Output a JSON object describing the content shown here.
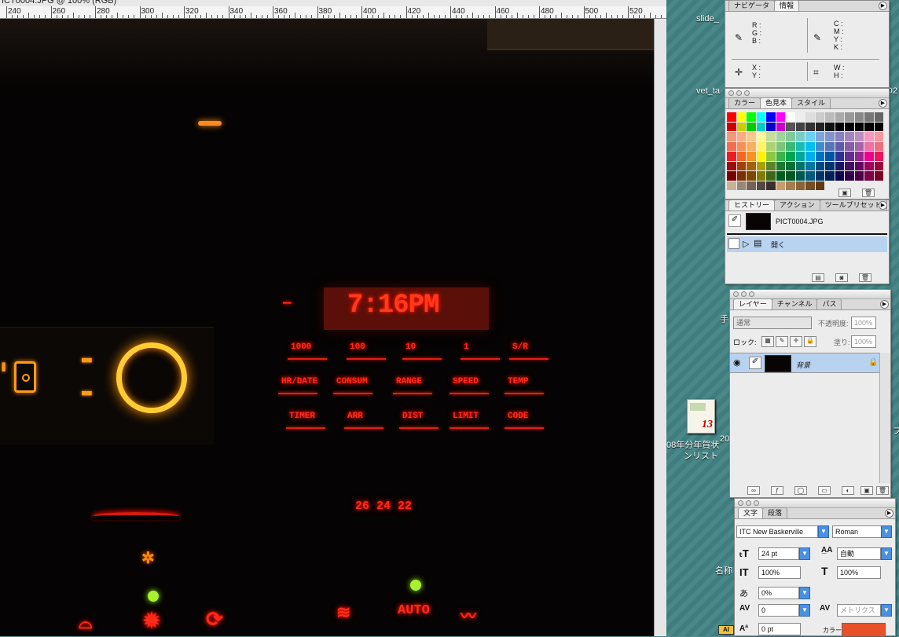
{
  "document": {
    "title": "ICT0004.JPG @ 100% (RGB)",
    "ruler_labels": [
      "240",
      "260",
      "280",
      "300",
      "320",
      "340",
      "360",
      "380",
      "400",
      "420",
      "440",
      "460",
      "480",
      "500",
      "520"
    ]
  },
  "photo": {
    "clock": "7:16PM",
    "top_buttons": [
      "1000",
      "100",
      "10",
      "1",
      "S/R"
    ],
    "mid_buttons": [
      "HR/DATE",
      "CONSUM",
      "RANGE",
      "SPEED",
      "TEMP"
    ],
    "bottom_buttons": [
      "TIMER",
      "ARR",
      "DIST",
      "LIMIT",
      "CODE"
    ],
    "temps": "26  24  22",
    "auto": "AUTO"
  },
  "info_panel": {
    "tabs": [
      "ナビゲータ",
      "情報"
    ],
    "rgb": [
      "R :",
      "G :",
      "B :"
    ],
    "cmyk": [
      "C :",
      "M :",
      "Y :",
      "K :"
    ],
    "xy": [
      "X :",
      "Y :"
    ],
    "wh": [
      "W :",
      "H :"
    ]
  },
  "swatch_panel": {
    "tabs": [
      "カラー",
      "色見本",
      "スタイル"
    ],
    "colors": [
      "#ff0000",
      "#ffff00",
      "#00ff00",
      "#00ffff",
      "#0000ff",
      "#ff00ff",
      "#ffffff",
      "#eeeeee",
      "#dddddd",
      "#cccccc",
      "#bbbbbb",
      "#aaaaaa",
      "#999999",
      "#888888",
      "#777777",
      "#666666",
      "#cc0000",
      "#cccc00",
      "#00cc00",
      "#00cccc",
      "#0000cc",
      "#cc00cc",
      "#555555",
      "#444444",
      "#333333",
      "#222222",
      "#111111",
      "#000000",
      "#000000",
      "#000000",
      "#000000",
      "#000000",
      "#f7977a",
      "#f9ad81",
      "#fdc68a",
      "#fff79a",
      "#c4df9b",
      "#a3d39c",
      "#82ca9d",
      "#7bcdc8",
      "#6ecff6",
      "#7ea7d8",
      "#8493ca",
      "#8882be",
      "#a187be",
      "#bc8dbf",
      "#f49ac2",
      "#f6989d",
      "#f26c4f",
      "#f68e55",
      "#fbaf5c",
      "#fff467",
      "#acd372",
      "#7cc576",
      "#3bb878",
      "#1abbb4",
      "#00bff3",
      "#438ccb",
      "#5574b9",
      "#605ca8",
      "#855fa8",
      "#a763a8",
      "#f06ea9",
      "#f26d7d",
      "#ed1c24",
      "#f26522",
      "#f7941d",
      "#fff200",
      "#8dc73f",
      "#39b54a",
      "#00a651",
      "#00a99d",
      "#00aeef",
      "#0072bc",
      "#0054a6",
      "#2e3192",
      "#662d91",
      "#92278f",
      "#ec008c",
      "#ed145b",
      "#9e0b0f",
      "#a0410d",
      "#a36209",
      "#aba000",
      "#598527",
      "#1a7b30",
      "#007236",
      "#00746b",
      "#0076a3",
      "#004b80",
      "#003471",
      "#1b1464",
      "#440e62",
      "#630460",
      "#9e005d",
      "#9e0039",
      "#790000",
      "#7b2e00",
      "#7d4900",
      "#827b00",
      "#406618",
      "#005e20",
      "#005826",
      "#005952",
      "#005b7f",
      "#003663",
      "#002157",
      "#0d004c",
      "#32004b",
      "#4b0049",
      "#7b0046",
      "#7a0026",
      "#c7b299",
      "#998675",
      "#736357",
      "#534741",
      "#37302d",
      "#c69c6d",
      "#a67c52",
      "#8c6239",
      "#754c24",
      "#603913",
      "#ececec",
      "#ececec",
      "#ececec",
      "#ececec",
      "#ececec",
      "#ececec"
    ]
  },
  "history_panel": {
    "tabs": [
      "ヒストリー",
      "アクション",
      "ツールプリセット"
    ],
    "snapshot": "PICT0004.JPG",
    "state": "開く"
  },
  "layers_panel": {
    "tabs": [
      "レイヤー",
      "チャンネル",
      "パス"
    ],
    "blend_mode": "通常",
    "opacity_label": "不透明度:",
    "opacity_value": "100%",
    "lock_label": "ロック:",
    "fill_label": "塗り:",
    "fill_value": "100%",
    "layer_name": "背景"
  },
  "char_panel": {
    "tabs": [
      "文字",
      "段落"
    ],
    "font": "ITC New Baskerville",
    "style": "Roman",
    "size": "24 pt",
    "leading": "自動",
    "vscale": "100%",
    "hscale": "100%",
    "tsume": "0%",
    "kerning": "0",
    "tracking": "メトリクス",
    "baseline": "0 pt",
    "color_label": "カラー:",
    "color": "#e8502a"
  },
  "desktop": {
    "icon1": "slide_",
    "icon2": "vet_ta",
    "icon3_line1": "08年分年賀状",
    "icon3_line2": "ンリスト",
    "icon3_badge": "13",
    "side1": "手",
    "side2": "名称",
    "side3": "20",
    "side4": "D2",
    "side5": "フ",
    "tiny": "AI"
  }
}
